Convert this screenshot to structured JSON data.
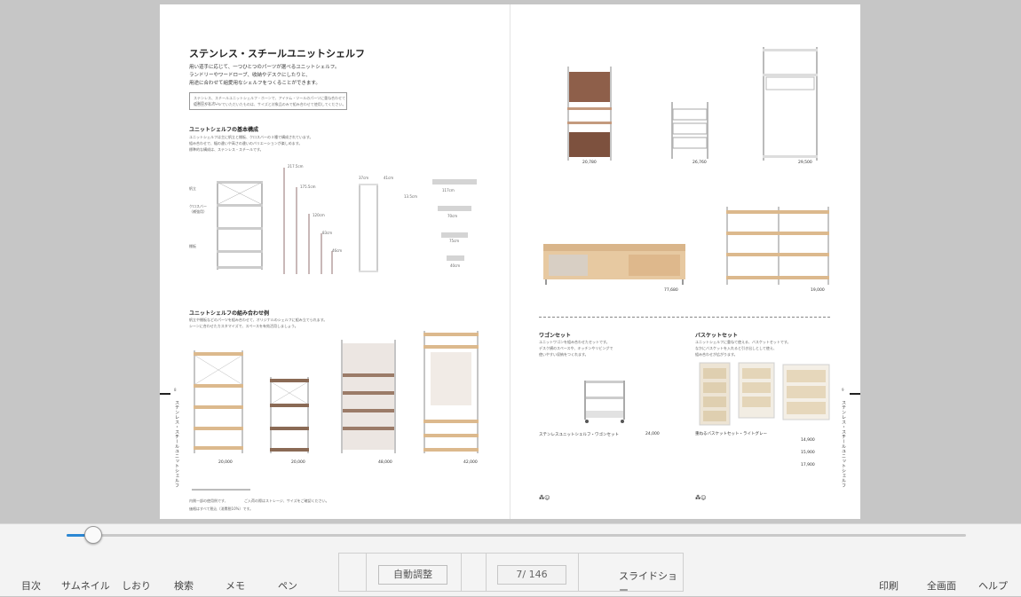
{
  "page": {
    "left": {
      "title": "ステンレス・スチールユニットシェルフ",
      "lead": [
        "用い道手に応じて、一つひとつのパーツが選べるユニットシェルフ。",
        "ランドリーやワードローブ、收納やデスクにしたりと、",
        "用途に合わせて組愛用なシェルフをつくることができます。"
      ],
      "note": [
        "ステンレス、スチールユニットシェルフ・ホーンで、アイテム・ツールのパーツに重ね合わせてご利用ください。",
        "組合上がるパーツでいただいたものは、サイズと対象品のみで組み合わせて使用してください。"
      ],
      "basic_heading": "ユニットシェルフの基本構成",
      "basic_desc": [
        "ユニットシェルフは主に帆立と棚板、クロスバーの３種で構成されています。",
        "組み合わせで、幅の違いや高さの違いのバリエーションが楽しめます。",
        "標準的な構成は、ステンレス・スチールです。"
      ],
      "labels": {
        "post": "帆立",
        "cross": "クロスバー\n（補強用）",
        "shelf": "棚板",
        "h1": "217.5cm",
        "h2": "175.5cm",
        "h3": "120cm",
        "h4": "83cm",
        "h5": "46cm",
        "w1": "37cm",
        "w2": "41cm",
        "w3": "56cm",
        "w4": "84cm",
        "d1": "13.5cm",
        "sw1": "117cm",
        "sw2": "70cm",
        "sw3": "75cm",
        "sw4": "40cm"
      },
      "combo_heading": "ユニットシェルフの組み合わせ例",
      "combo_desc": [
        "帆立や棚板などのパーツを組み合わせて、オリジナルのシェルフに組み立てられます。",
        "シーンに合わせたカスタマイズで、スペースを有効活用しましょう。"
      ],
      "prices": [
        "20,000",
        "20,000",
        "48,000",
        "42,000"
      ],
      "footer": [
        "内側一部の使用例です、",
        "ご入荷の際はストレージ、サイズをご確認ください。",
        "価格はすべて税込（消費税10%）です。"
      ],
      "page_no": "8",
      "side_text": "ステンレス・スチールユニットシェルフ"
    },
    "right": {
      "prices_top": [
        "20,780",
        "26,760",
        "29,500",
        "77,680",
        "19,000"
      ],
      "wagon": {
        "heading": "ワゴンセット",
        "desc": [
          "ユニットワゴンを組み合わせたセットです。",
          "デスク横のスペースや、キッチンやリビングで",
          "使いやすい収納をつくれます。"
        ],
        "name": "ステンレスユニットシェルフ・ワゴンセット",
        "price": "24,000"
      },
      "basket": {
        "heading": "バスケットセット",
        "desc": [
          "ユニットシェルフに重ねて使える、バスケットセットです。",
          "なかにバスケットを入れると引き出しとして使え、",
          "組み合わせが広がります。"
        ],
        "name": "重ねるバスケットセット・ライトグレー",
        "prices": [
          "14,900",
          "15,900",
          "17,900"
        ]
      },
      "page_no": "9",
      "side_text": "ステンレス・スチールユニットシェルフ"
    }
  },
  "slider": {
    "progress": 0.03
  },
  "toolbar": {
    "left_items": [
      "目次",
      "サムネイル",
      "しおり",
      "検索",
      "メモ",
      "ペン"
    ],
    "fit_button": "自動調整",
    "page_indicator": "7/ 146",
    "slideshow": "スライドショー",
    "right_items": [
      "印刷",
      "全画面",
      "ヘルプ"
    ]
  }
}
